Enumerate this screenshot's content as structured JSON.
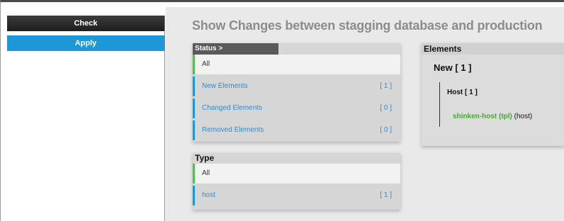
{
  "sidebar": {
    "check_label": "Check",
    "apply_label": "Apply"
  },
  "main": {
    "title": "Show Changes between stagging database and production"
  },
  "status_panel": {
    "header": "Status >",
    "all_label": "All",
    "items": [
      {
        "label": "New Elements",
        "count": "[ 1 ]"
      },
      {
        "label": "Changed Elements",
        "count": "[ 0 ]"
      },
      {
        "label": "Removed Elements",
        "count": "[ 0 ]"
      }
    ]
  },
  "type_panel": {
    "header": "Type",
    "all_label": "All",
    "items": [
      {
        "label": "host",
        "count": "[ 1 ]"
      }
    ]
  },
  "elements_panel": {
    "header": "Elements",
    "new_label": "New [ 1 ]",
    "host_label": "Host [ 1 ]",
    "element_name": "shinken-host (tpl)",
    "element_type": " (host)"
  },
  "colors": {
    "accent_blue": "#1f97d6",
    "all_green": "#5cb85c",
    "element_green": "#4aa43a"
  }
}
